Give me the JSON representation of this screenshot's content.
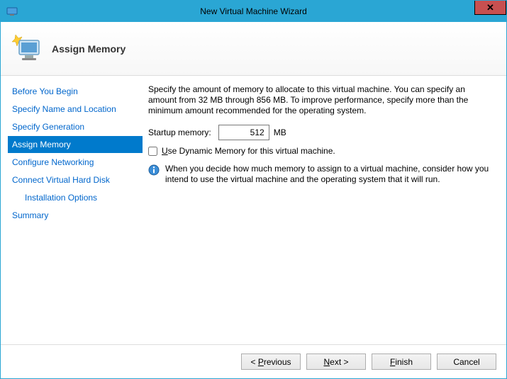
{
  "window": {
    "title": "New Virtual Machine Wizard"
  },
  "header": {
    "title": "Assign Memory"
  },
  "sidebar": {
    "items": [
      {
        "label": "Before You Begin"
      },
      {
        "label": "Specify Name and Location"
      },
      {
        "label": "Specify Generation"
      },
      {
        "label": "Assign Memory"
      },
      {
        "label": "Configure Networking"
      },
      {
        "label": "Connect Virtual Hard Disk"
      },
      {
        "label": "Installation Options"
      },
      {
        "label": "Summary"
      }
    ]
  },
  "content": {
    "description": "Specify the amount of memory to allocate to this virtual machine. You can specify an amount from 32 MB through 856 MB. To improve performance, specify more than the minimum amount recommended for the operating system.",
    "startup_label": "Startup memory:",
    "startup_value": "512",
    "startup_unit": "MB",
    "dynamic_prefix": "U",
    "dynamic_rest": "se Dynamic Memory for this virtual machine.",
    "info_text": "When you decide how much memory to assign to a virtual machine, consider how you intend to use the virtual machine and the operating system that it will run."
  },
  "footer": {
    "previous_pre": "< ",
    "previous_ul": "P",
    "previous_post": "revious",
    "next_ul": "N",
    "next_post": "ext >",
    "finish_ul": "F",
    "finish_post": "inish",
    "cancel": "Cancel"
  }
}
